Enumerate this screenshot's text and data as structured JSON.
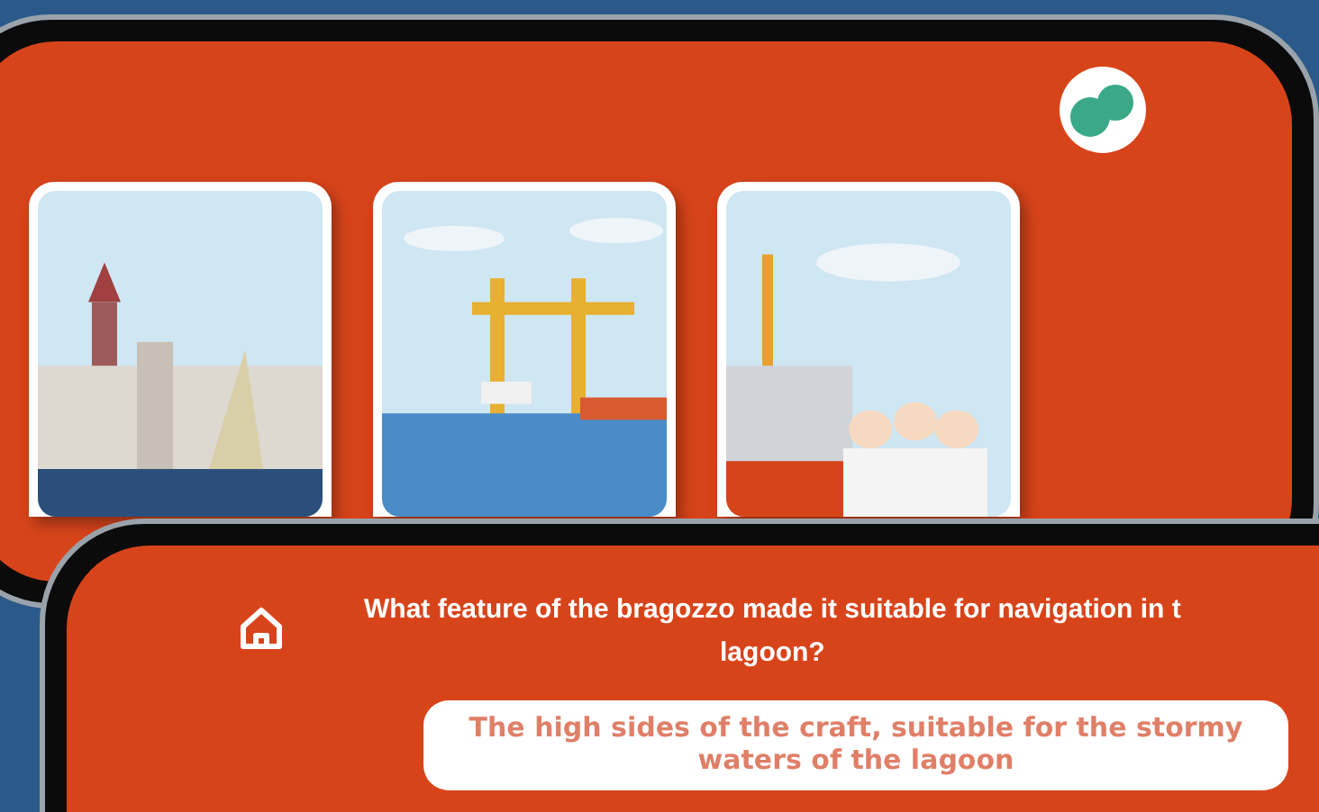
{
  "question_lines": [
    "What feature of the bragozzo made it suitable for navigation in t",
    "lagoon?"
  ],
  "answer": "The high sides of the craft, suitable for the stormy waters of the lagoon"
}
